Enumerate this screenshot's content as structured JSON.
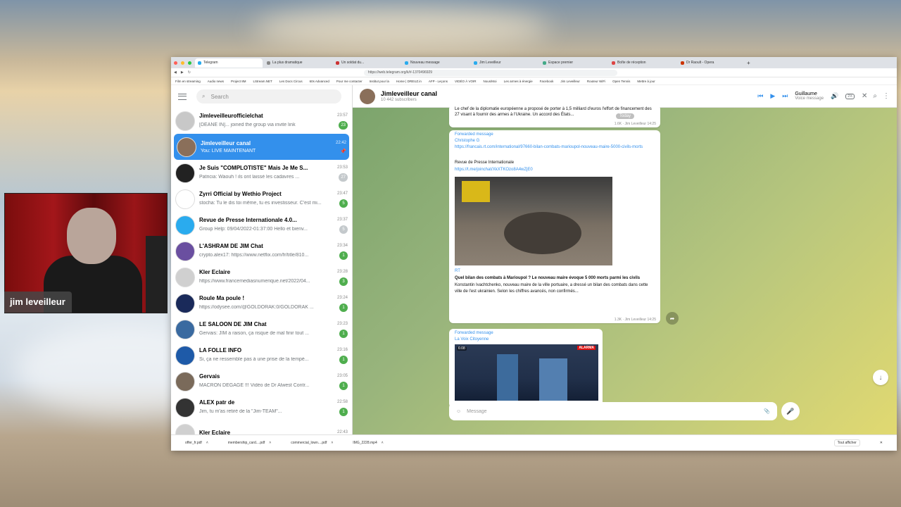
{
  "webcam": {
    "name_label": "jim leveilleur"
  },
  "browser": {
    "tabs": [
      {
        "title": "Telegram",
        "active": true
      },
      {
        "title": "La plus dramatique",
        "active": false
      },
      {
        "title": "Un soldat du...",
        "active": false
      },
      {
        "title": "Nouveau message",
        "active": false
      },
      {
        "title": "Jim Leveilleur",
        "active": false
      },
      {
        "title": "Espace premier",
        "active": false
      },
      {
        "title": "Boîte de réception",
        "active": false
      },
      {
        "title": "Dr Raoult - Opera",
        "active": false
      }
    ],
    "url": "https://web.telegram.org/k/#-1370496929",
    "bookmarks": [
      "Film en streaming",
      "Audio news",
      "Project 8M",
      "LStream.NET",
      "Les Docs Circus",
      "60s Advanced",
      "Pour me contacter",
      "Institut pour la",
      "Home | DREUZ.in",
      "AFP - Leçons",
      "VIDÉO À VOIR",
      "Nous/Moi",
      "Les armes à énergie",
      "Facebook",
      "Jim Leveilleur",
      "Routeur WiFi",
      "Open Tennis",
      "Mettre à jour"
    ],
    "downloads": [
      "offer_fr.pdf",
      "membership_card....pdf",
      "commercial_lown....pdf",
      "IMG_2228.mp4"
    ],
    "downloads_show_all": "Tout afficher"
  },
  "sidebar": {
    "search_placeholder": "Search",
    "chats": [
      {
        "name": "Jimleveilleurofficielchat",
        "time": "23:57",
        "msg": "[DEANE IN]... joined the group via invite link",
        "badge": "23",
        "muted": false,
        "active": false,
        "color": "#c8c8c8"
      },
      {
        "name": "Jimleveilleur canal",
        "time": "22:42",
        "msg": "You: LIVE MAINTENANT",
        "badge": "",
        "muted": false,
        "active": true,
        "color": "#8a6f5a"
      },
      {
        "name": "Je Suis \"COMPLOTISTE\" Mais Je Me S...",
        "time": "23:53",
        "msg": "Patricia: Waouh ! ils ont laissé les cadavres ...",
        "badge": "27",
        "muted": true,
        "active": false,
        "color": "#222222"
      },
      {
        "name": "Zyrri Official by Wethio Project",
        "time": "23:47",
        "msg": "stocha: Tu le dis toi même, tu es investisseur. C'est mi...",
        "badge": "5",
        "muted": false,
        "active": false,
        "color": "#ffffff"
      },
      {
        "name": "Revue de Presse Internationale 4.0...",
        "time": "23:37",
        "msg": "Group Help: 09/04/2022-01:37:00 Hello et bienv...",
        "badge": "5",
        "muted": true,
        "active": false,
        "color": "#2aabee"
      },
      {
        "name": "L'ASHRAM DE JIM Chat",
        "time": "23:34",
        "msg": "crypto.alex17: https://www.netflix.com/fr/title/810...",
        "badge": "1",
        "muted": false,
        "active": false,
        "color": "#6a4fa0"
      },
      {
        "name": "Kler Eclaire",
        "time": "23:28",
        "msg": "https://www.francemediasnumerique.net/2022/04...",
        "badge": "3",
        "muted": false,
        "active": false,
        "color": "#d0d0d0"
      },
      {
        "name": "Roule Ma poule !",
        "time": "23:24",
        "msg": "https://odysee.com/@GOLDORAK:0/GOLDORAK ...",
        "badge": "1",
        "muted": false,
        "active": false,
        "color": "#1a2a5a"
      },
      {
        "name": "LE SALOON DE JIM Chat",
        "time": "23:23",
        "msg": "Gervais: JIM a raison, ça risque de mal finir tout ...",
        "badge": "1",
        "muted": false,
        "active": false,
        "color": "#3a6aa0"
      },
      {
        "name": "LA FOLLE INFO",
        "time": "23:16",
        "msg": "Si, ça ne ressemble pas à une prise de la tempé...",
        "badge": "1",
        "muted": false,
        "active": false,
        "color": "#1e5aa8"
      },
      {
        "name": "Gervais",
        "time": "23:05",
        "msg": "MACRON DÉGAGE !!! Vidéo de Dr Alwest Contr...",
        "badge": "1",
        "muted": false,
        "active": false,
        "color": "#7a6a5a"
      },
      {
        "name": "ALEX patr de",
        "time": "22:58",
        "msg": "Jim, tu m'as retiré de la \"Jim-TEAM\"...",
        "badge": "1",
        "muted": false,
        "active": false,
        "color": "#333333"
      },
      {
        "name": "Kler Eclaire",
        "time": "22:43",
        "msg": "",
        "badge": "",
        "muted": false,
        "active": false,
        "color": "#d0d0d0"
      }
    ]
  },
  "chat_header": {
    "title": "Jimleveilleur canal",
    "subscribers": "10 442 subscribers",
    "player_title": "Guillaume",
    "player_sub": "Voice message",
    "rate": "2X"
  },
  "messages": {
    "date_pill": "Today",
    "m1_text": "Le chef de la diplomatie européenne a proposé de porter à 1,5 milliard d'euros l'effort de financement des 27 visant à fournir des armes à l'Ukraine. Un accord des États...",
    "m1_meta": "1.6K · Jim Leveilleur 14:25",
    "m2_fwd": "Forwarded message",
    "m2_from": "Christophe G",
    "m2_link": "https://francais.rt.com/international/97660-bilan-combats-marioupol-nouveau-maire-5000-civils-morts",
    "m2_title": "Revue de Presse Internationale",
    "m2_link2": "https://t.me/joinchat/XkXTKOzo8A4wZjE0",
    "m2_source": "RT",
    "m2_headline": "Quel bilan des combats à Marioupol ? Le nouveau maire évoque 5 000 morts parmi les civils",
    "m2_body": "Konstantin Ivachtchenko, nouveau maire de la ville portuaire, a dressé un bilan des combats dans cette ville de l'est ukrainien. Selon les chiffres avancés, non confirmés...",
    "m2_meta": "1.3K · Jim Leveilleur 14:25",
    "m3_fwd": "Forwarded message",
    "m3_from": "La Voix Citoyenne",
    "m3_duration": "6:08",
    "m3_logo": "ALARMA"
  },
  "composer": {
    "placeholder": "Message"
  }
}
